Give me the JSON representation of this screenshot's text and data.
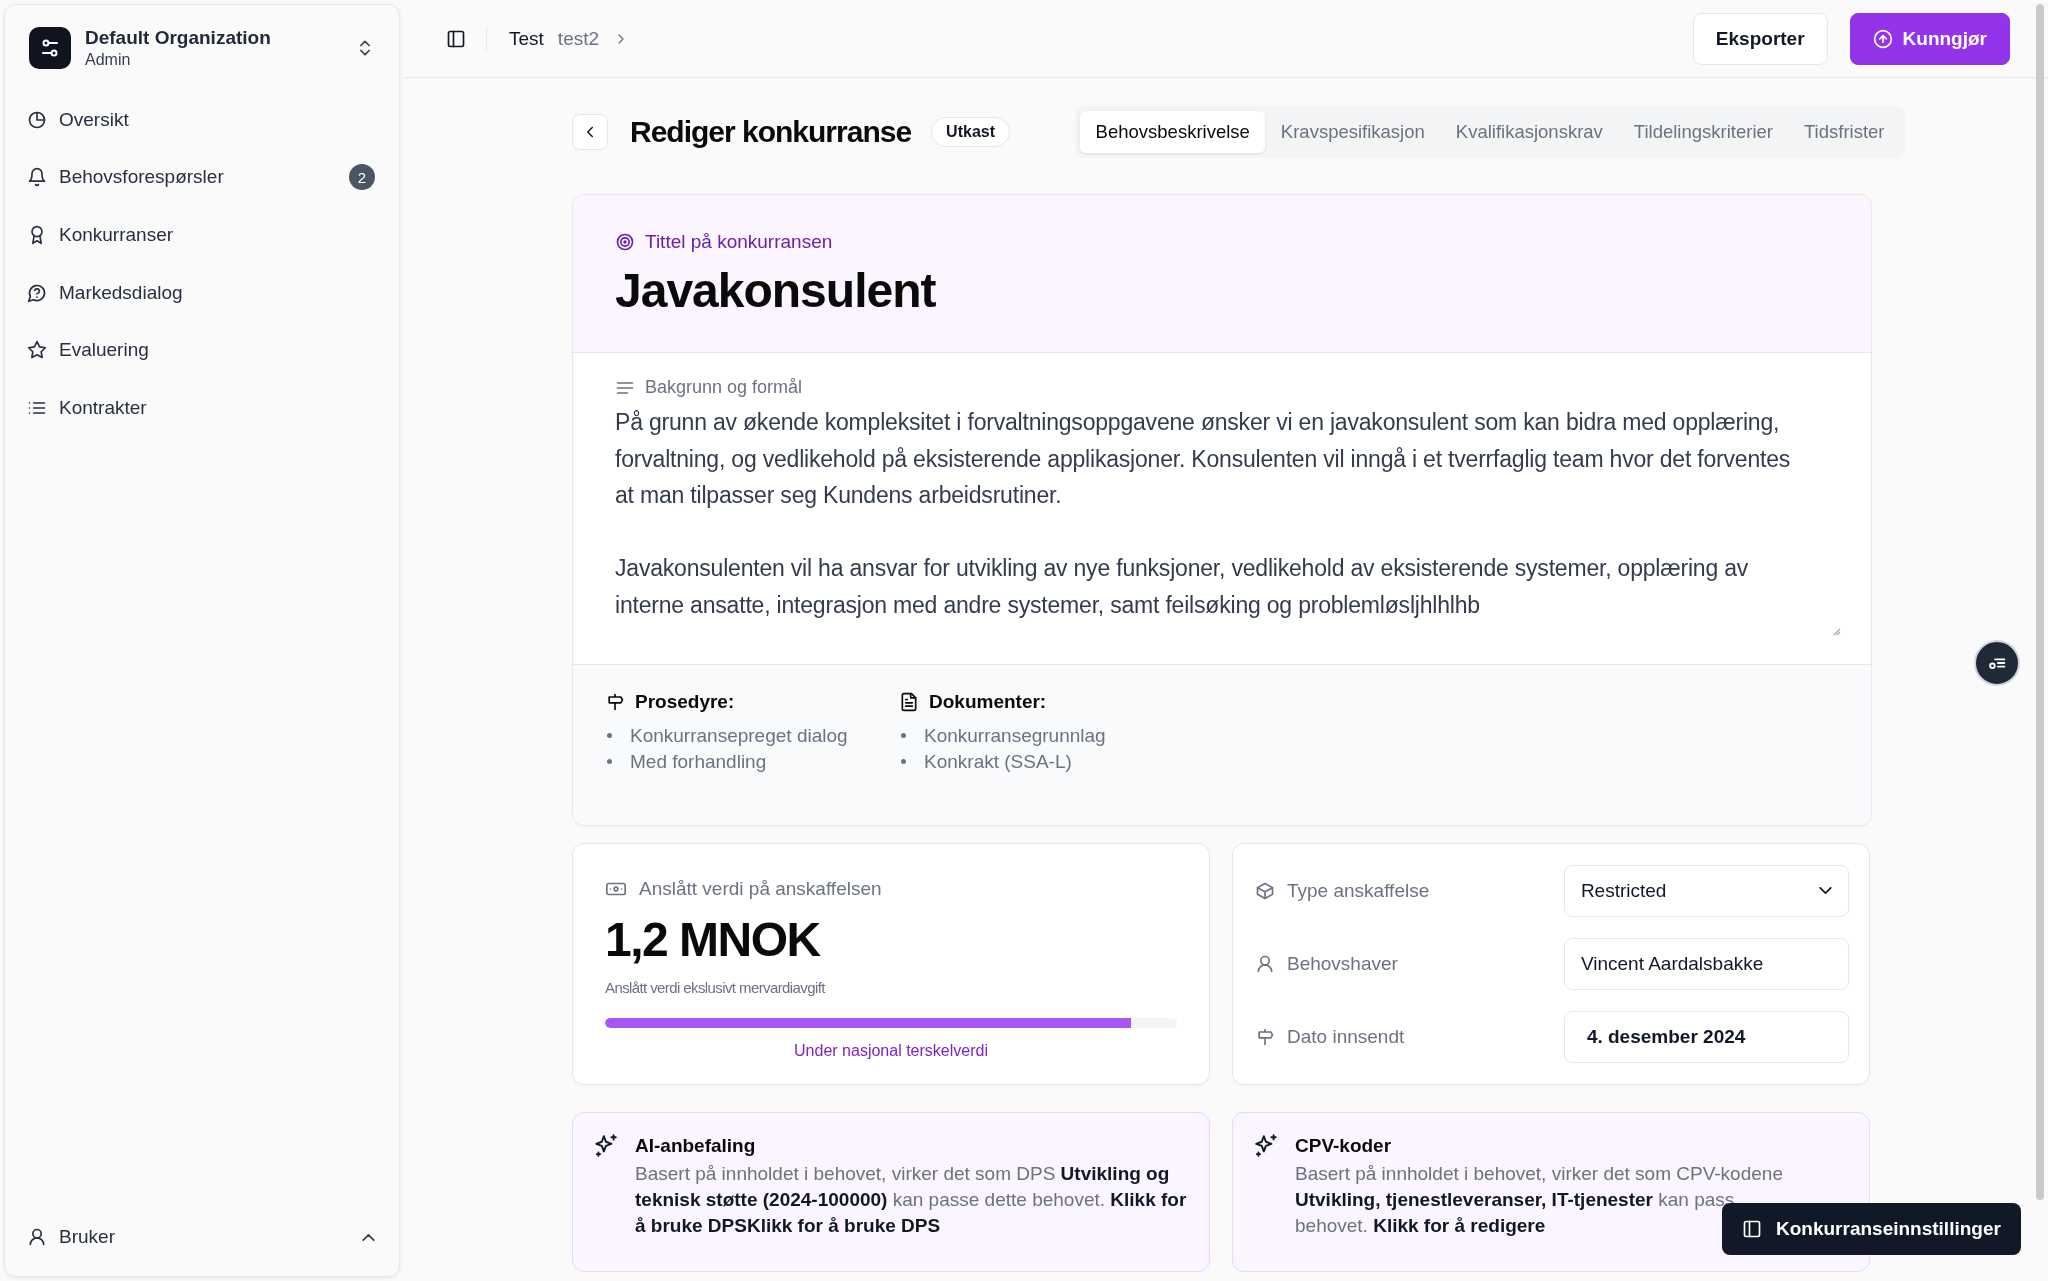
{
  "sidebar": {
    "organization": {
      "name": "Default Organization",
      "role": "Admin"
    },
    "items": [
      {
        "label": "Oversikt",
        "selected": false
      },
      {
        "label": "Behovsforespørsler",
        "selected": false,
        "badge": "2"
      },
      {
        "label": "Konkurranser",
        "selected": false
      },
      {
        "label": "Markedsdialog",
        "selected": false
      },
      {
        "label": "Evaluering",
        "selected": false
      },
      {
        "label": "Kontrakter",
        "selected": false
      }
    ],
    "user": {
      "label": "Bruker"
    }
  },
  "header": {
    "breadcrumbs": [
      "Test",
      "test2"
    ],
    "buttons": [
      {
        "label": "Eksporter",
        "kind": "secondary"
      },
      {
        "label": "Kunngjør",
        "kind": "primary"
      }
    ]
  },
  "page": {
    "title": "Rediger konkurranse",
    "status": "Utkast",
    "tabs": [
      {
        "label": "Behovsbeskrivelse",
        "selected": true
      },
      {
        "label": "Kravspesifikasjon",
        "selected": false
      },
      {
        "label": "Kvalifikasjonskrav",
        "selected": false
      },
      {
        "label": "Tildelingskriterier",
        "selected": false
      },
      {
        "label": "Tidsfrister",
        "selected": false
      }
    ]
  },
  "title_card": {
    "label": "Tittel på konkurransen",
    "title": "Javakonsulent"
  },
  "description": {
    "label": "Bakgrunn og formål",
    "value": "På grunn av økende kompleksitet i forvaltningsoppgavene ønsker vi en javakonsulent som kan bidra med opplæring, forvaltning, og vedlikehold på eksisterende applikasjoner. Konsulenten vil inngå i et tverrfaglig team hvor det forventes at man tilpasser seg Kundens arbeidsrutiner.\n\nJavakonsulenten vil ha ansvar for utvikling av nye funksjoner, vedlikehold av eksisterende systemer, opplæring av interne ansatte, integrasjon med andre systemer, samt feilsøking og problemløsljhlhlhb"
  },
  "summary": [
    {
      "label": "Prosedyre:",
      "items": [
        "Konkurransepreget dialog",
        "Med forhandling"
      ]
    },
    {
      "label": "Dokumenter:",
      "items": [
        "Konkurransegrunnlag",
        "Konkrakt (SSA-L)"
      ]
    }
  ],
  "estimate": {
    "label": "Anslått verdi på anskaffelsen",
    "value": "1,2 MNOK",
    "note": "Anslått verdi ekslusivt mervardiavgift",
    "level": 0.92,
    "threshold": "Under nasjonal terskelverdi"
  },
  "details": [
    {
      "label": "Type anskaffelse",
      "value": "Restricted",
      "kind": "select"
    },
    {
      "label": "Behovshaver",
      "value": "Vincent Aardalsbakke",
      "kind": "input"
    },
    {
      "label": "Dato innsendt",
      "value": "4. desember 2024",
      "kind": "date"
    }
  ],
  "suggestions": [
    {
      "title": "AI-anbefaling",
      "lines": [
        "Basert på innholdet i behovet, virker det som DPS **Utvikling og**",
        "**teknisk støtte (2024-100000)** kan passe dette behovet. **Klikk for**",
        "**å bruke DPSKlikk for å bruke DPS**"
      ]
    },
    {
      "title": "CPV-koder",
      "lines": [
        "Basert på innholdet i behovet, virker det som CPV-kodene",
        "**Utvikling, tjenestleveranser, IT-tjenester** kan pass",
        "behovet. **Klikk for å redigere**"
      ]
    }
  ],
  "settings_button": {
    "label": "Konkurranseinnstillinger"
  }
}
